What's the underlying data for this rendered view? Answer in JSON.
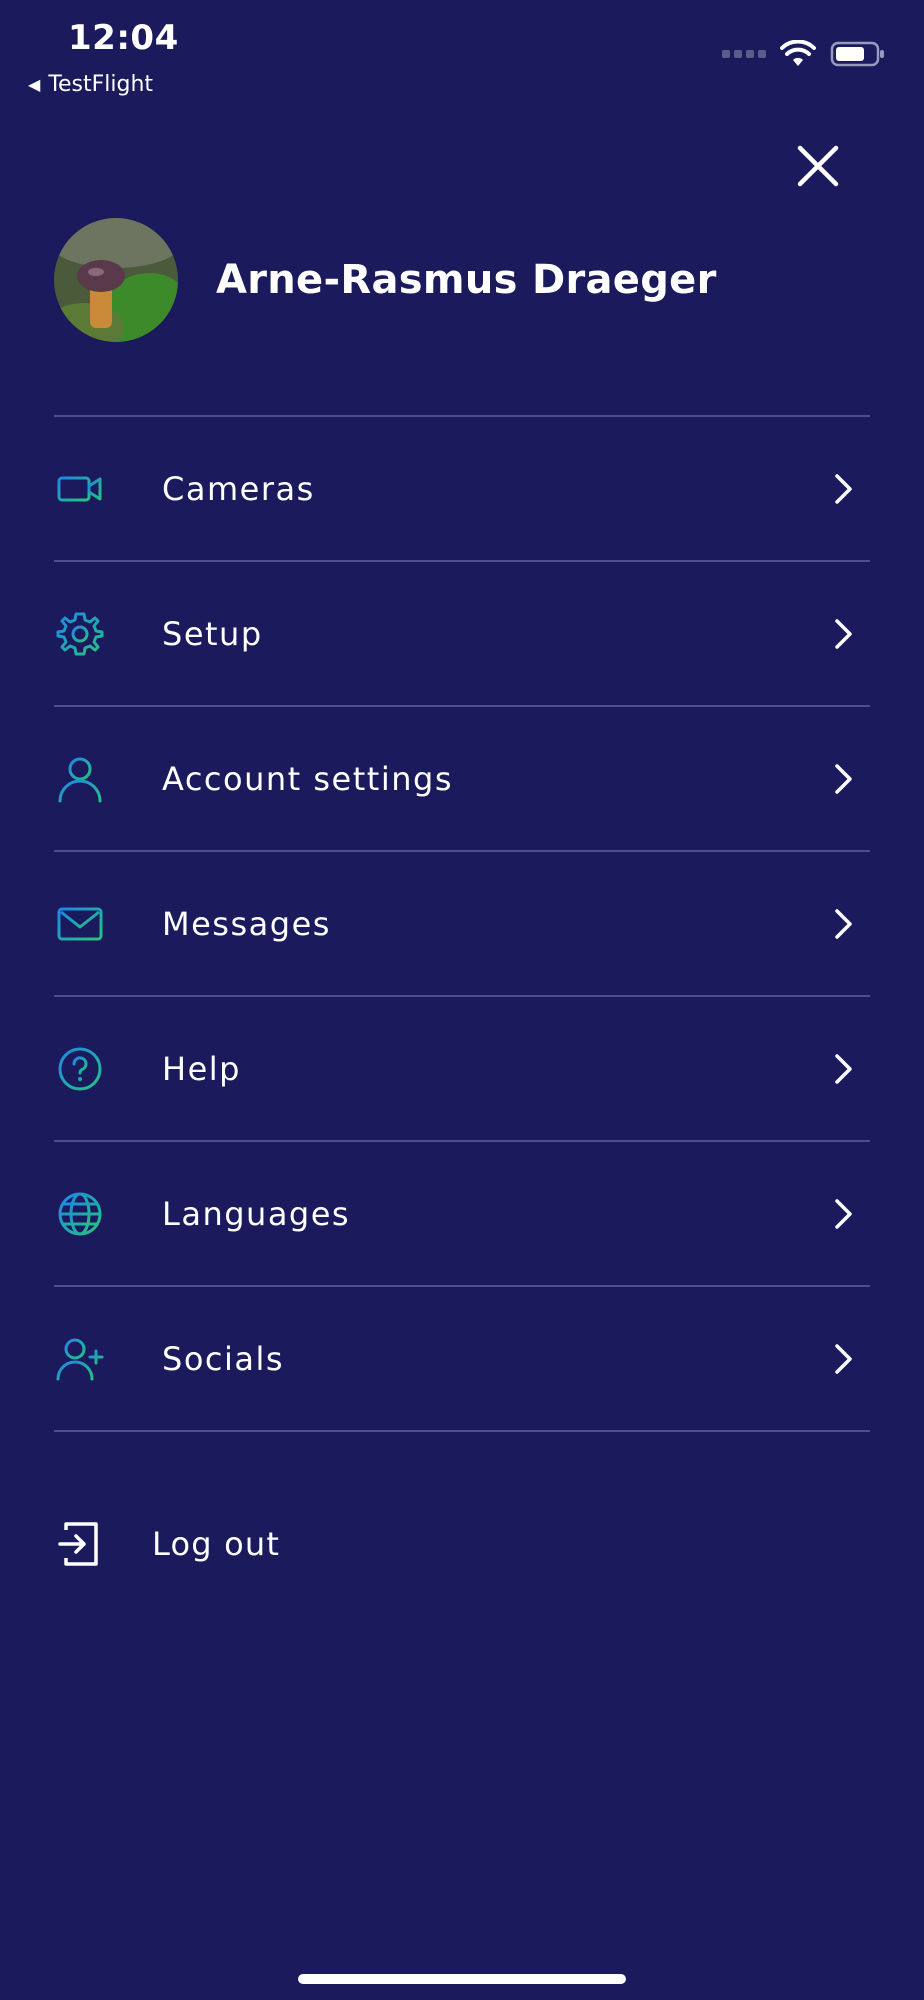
{
  "status_bar": {
    "time": "12:04",
    "back_app": "TestFlight"
  },
  "profile": {
    "name": "Arne-Rasmus Draeger"
  },
  "menu": {
    "items": [
      {
        "label": "Cameras",
        "icon": "video-camera-icon"
      },
      {
        "label": "Setup",
        "icon": "gear-icon"
      },
      {
        "label": "Account settings",
        "icon": "user-icon"
      },
      {
        "label": "Messages",
        "icon": "envelope-icon"
      },
      {
        "label": "Help",
        "icon": "help-circle-icon"
      },
      {
        "label": "Languages",
        "icon": "globe-icon"
      },
      {
        "label": "Socials",
        "icon": "user-plus-icon"
      }
    ]
  },
  "logout": {
    "label": "Log out",
    "icon": "logout-icon"
  },
  "colors": {
    "background": "#1a1a5c",
    "divider": "#4e4e88",
    "gradient_start": "#1e88e5",
    "gradient_end": "#26c281",
    "text": "#ffffff"
  }
}
